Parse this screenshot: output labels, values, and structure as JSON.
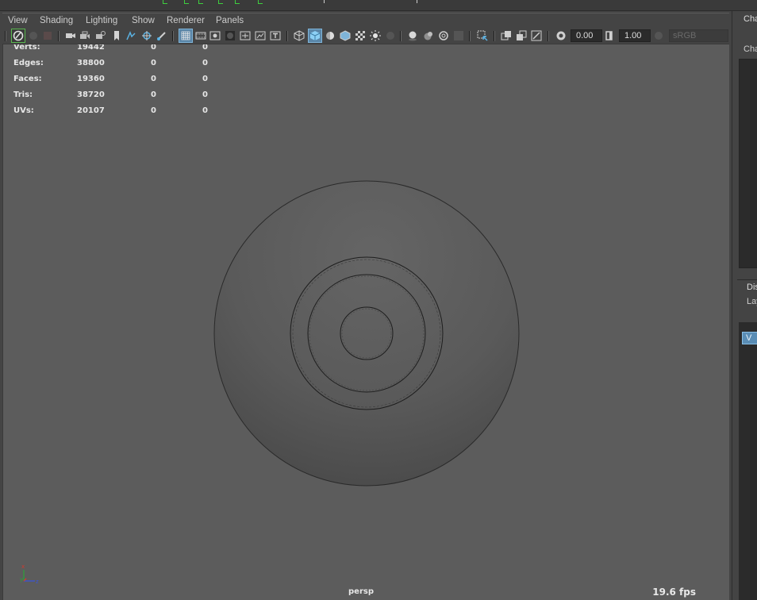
{
  "menubar": {
    "items": [
      "View",
      "Shading",
      "Lighting",
      "Show",
      "Renderer",
      "Panels"
    ]
  },
  "toolbar": {
    "exposure_value": "0.00",
    "gamma_value": "1.00",
    "color_space_label": "sRGB gamma",
    "icons": [
      "select-camera-icon",
      "lock-camera-icon",
      "camera-attributes-icon",
      "bookmark-icon",
      "image-plane-icon",
      "2d-pan-zoom-icon",
      "grease-pencil-icon",
      "grid-icon",
      "film-gate-icon",
      "resolution-gate-icon",
      "gate-mask-icon",
      "field-chart-icon",
      "safe-action-icon",
      "safe-title-icon",
      "wireframe-icon",
      "smooth-shade-icon",
      "default-material-icon",
      "wireframe-on-shaded-icon",
      "textured-icon",
      "use-all-lights-icon",
      "shadows-icon",
      "screen-space-ao-icon",
      "motion-blur-icon",
      "anti-aliasing-icon",
      "depth-of-field-icon",
      "isolate-select-icon",
      "xray-icon",
      "xray-active-components-icon",
      "xray-joints-icon",
      "exposure-icon",
      "gamma-icon",
      "view-transform-icon"
    ]
  },
  "hud": {
    "rows": [
      {
        "label": "Verts:",
        "values": [
          "19442",
          "0",
          "0"
        ]
      },
      {
        "label": "Edges:",
        "values": [
          "38800",
          "0",
          "0"
        ]
      },
      {
        "label": "Faces:",
        "values": [
          "19360",
          "0",
          "0"
        ]
      },
      {
        "label": "Tris:",
        "values": [
          "38720",
          "0",
          "0"
        ]
      },
      {
        "label": "UVs:",
        "values": [
          "20107",
          "0",
          "0"
        ]
      }
    ],
    "camera_name": "persp",
    "fps": "19.6 fps"
  },
  "axis": {
    "x": "x",
    "y": "y",
    "z": "z"
  },
  "right_panel": {
    "tab_label": "Cha",
    "channel_label": "Cha",
    "display_label": "Dis",
    "layers_label": "Lay",
    "layer_button": "V"
  },
  "colors": {
    "viewport_bg": "#5c5c5c",
    "panel_bg": "#444444",
    "active_icon": "#5ab2e3",
    "timeline_marker": "#3ecf3e"
  }
}
